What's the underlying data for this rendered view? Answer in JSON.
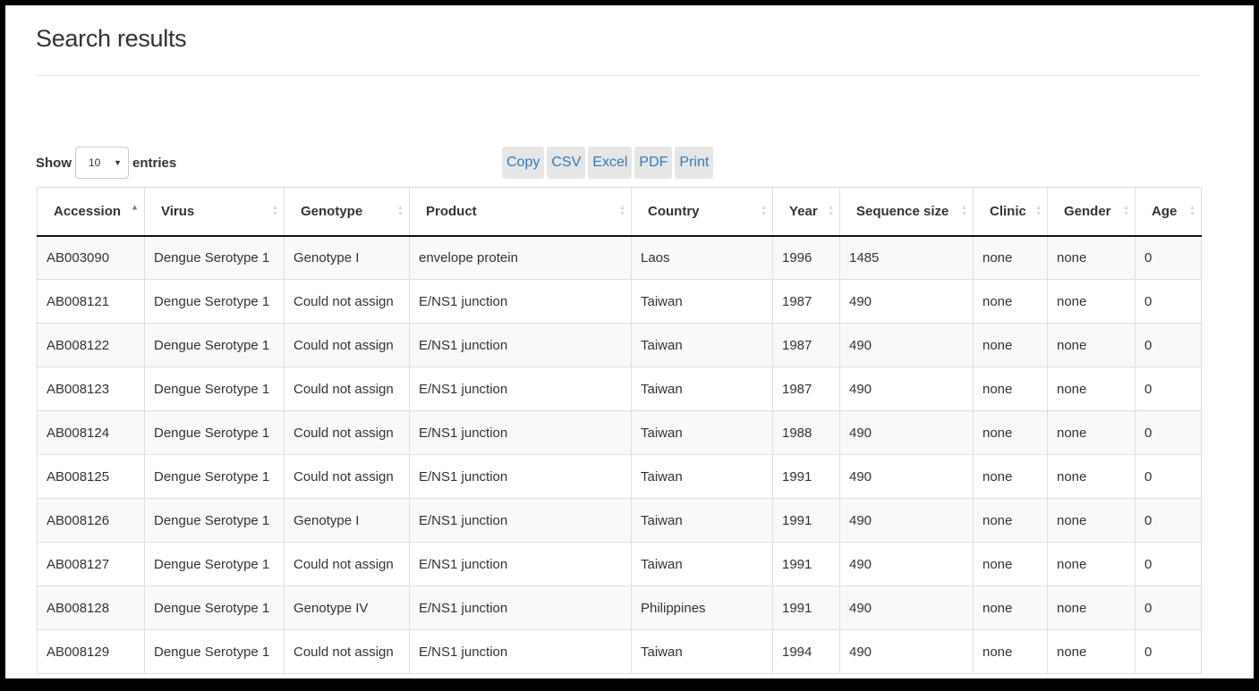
{
  "page": {
    "title": "Search results"
  },
  "length_menu": {
    "prefix": "Show",
    "value": "10",
    "suffix": "entries"
  },
  "buttons": [
    "Copy",
    "CSV",
    "Excel",
    "PDF",
    "Print"
  ],
  "table": {
    "columns": [
      {
        "label": "Accession",
        "sort": "asc"
      },
      {
        "label": "Virus",
        "sort": "both"
      },
      {
        "label": "Genotype",
        "sort": "both"
      },
      {
        "label": "Product",
        "sort": "both"
      },
      {
        "label": "Country",
        "sort": "both"
      },
      {
        "label": "Year",
        "sort": "both"
      },
      {
        "label": "Sequence size",
        "sort": "both"
      },
      {
        "label": "Clinic",
        "sort": "both"
      },
      {
        "label": "Gender",
        "sort": "both"
      },
      {
        "label": "Age",
        "sort": "both"
      }
    ],
    "rows": [
      [
        "AB003090",
        "Dengue Serotype 1",
        "Genotype I",
        "envelope protein",
        "Laos",
        "1996",
        "1485",
        "none",
        "none",
        "0"
      ],
      [
        "AB008121",
        "Dengue Serotype 1",
        "Could not assign",
        "E/NS1 junction",
        "Taiwan",
        "1987",
        "490",
        "none",
        "none",
        "0"
      ],
      [
        "AB008122",
        "Dengue Serotype 1",
        "Could not assign",
        "E/NS1 junction",
        "Taiwan",
        "1987",
        "490",
        "none",
        "none",
        "0"
      ],
      [
        "AB008123",
        "Dengue Serotype 1",
        "Could not assign",
        "E/NS1 junction",
        "Taiwan",
        "1987",
        "490",
        "none",
        "none",
        "0"
      ],
      [
        "AB008124",
        "Dengue Serotype 1",
        "Could not assign",
        "E/NS1 junction",
        "Taiwan",
        "1988",
        "490",
        "none",
        "none",
        "0"
      ],
      [
        "AB008125",
        "Dengue Serotype 1",
        "Could not assign",
        "E/NS1 junction",
        "Taiwan",
        "1991",
        "490",
        "none",
        "none",
        "0"
      ],
      [
        "AB008126",
        "Dengue Serotype 1",
        "Genotype I",
        "E/NS1 junction",
        "Taiwan",
        "1991",
        "490",
        "none",
        "none",
        "0"
      ],
      [
        "AB008127",
        "Dengue Serotype 1",
        "Could not assign",
        "E/NS1 junction",
        "Taiwan",
        "1991",
        "490",
        "none",
        "none",
        "0"
      ],
      [
        "AB008128",
        "Dengue Serotype 1",
        "Genotype IV",
        "E/NS1 junction",
        "Philippines",
        "1991",
        "490",
        "none",
        "none",
        "0"
      ],
      [
        "AB008129",
        "Dengue Serotype 1",
        "Could not assign",
        "E/NS1 junction",
        "Taiwan",
        "1994",
        "490",
        "none",
        "none",
        "0"
      ]
    ]
  },
  "colors": {
    "link": "#337ab7",
    "button_bg": "#e6e6e6",
    "sort_active": "#5b7fd6",
    "sort_inactive": "#d6d6d6"
  }
}
